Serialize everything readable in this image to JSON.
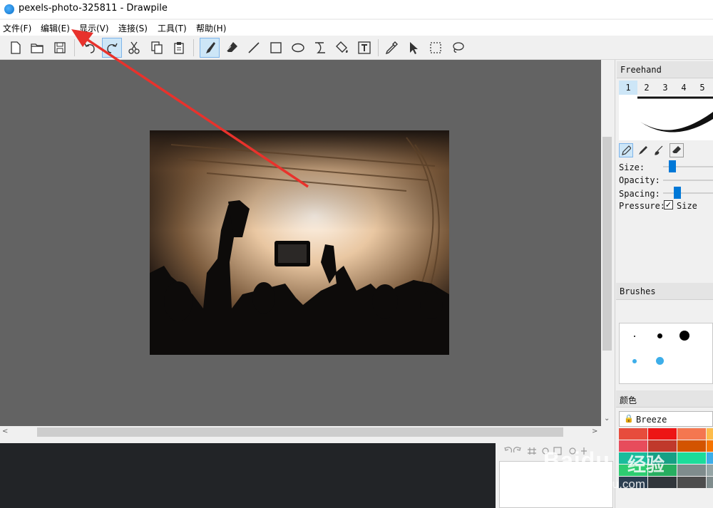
{
  "window": {
    "title": "pexels-photo-325811 - Drawpile"
  },
  "menu": [
    "文件(F)",
    "编辑(E)",
    "显示(V)",
    "连接(S)",
    "工具(T)",
    "帮助(H)"
  ],
  "toolbar": {
    "buttons": [
      "new-document-icon",
      "open-folder-icon",
      "save-icon",
      "undo-icon",
      "redo-icon",
      "cut-icon",
      "copy-icon",
      "paste-icon",
      "freehand-brush-icon",
      "eraser-icon",
      "line-icon",
      "rectangle-icon",
      "ellipse-icon",
      "bezier-icon",
      "fill-bucket-icon",
      "text-icon",
      "color-picker-icon",
      "select-arrow-icon",
      "rect-select-icon",
      "lasso-icon"
    ],
    "active": [
      "redo-icon",
      "freehand-brush-icon"
    ]
  },
  "dock": {
    "tool_settings": {
      "title": "Freehand",
      "presets": [
        "1",
        "2",
        "3",
        "4",
        "5"
      ],
      "active_preset": "1",
      "size_label": "Size:",
      "opacity_label": "Opacity:",
      "spacing_label": "Spacing:",
      "pressure_label": "Pressure:",
      "pressure_size_label": "Size",
      "pressure_size_checked": true,
      "size_level": 0.12,
      "spacing_level": 0.22
    },
    "brushes": {
      "title": "Brushes"
    },
    "color": {
      "title": "颜色",
      "palette_name": "Breeze",
      "swatches": [
        "#e74c3c",
        "#ed1515",
        "#f47750",
        "#fdbc4b",
        "#e74c5c",
        "#c0392b",
        "#d35400",
        "#f67400",
        "#1abc9c",
        "#16a085",
        "#1cdc9a",
        "#3daee9",
        "#2ecc71",
        "#27ae60",
        "#7f8c8d",
        "#95a5a6",
        "#2c3e50",
        "#31363b",
        "#4d4d4d",
        "#7f8c8d"
      ]
    }
  },
  "watermark": {
    "brand": "Baidu",
    "cn": "经验",
    "url": "jingyan.baidu.com"
  },
  "colors": {
    "accent": "#0078d7",
    "annotation": "#e8322c",
    "canvas_bg": "#636363"
  }
}
